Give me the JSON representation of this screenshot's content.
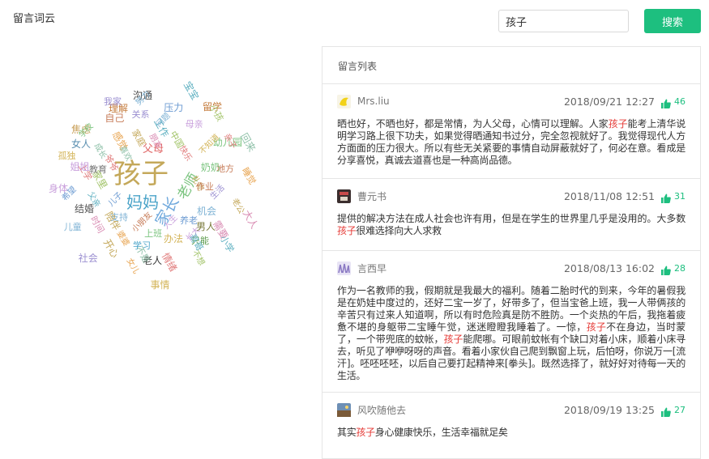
{
  "page": {
    "title": "留言词云"
  },
  "search": {
    "value": "孩子",
    "button": "搜索"
  },
  "word_cloud": {
    "words": [
      "孩子",
      "妈妈",
      "家长",
      "老师",
      "父母",
      "沟通",
      "理解",
      "结婚",
      "男人",
      "老人",
      "女人",
      "教育",
      "焦虑",
      "学习",
      "留学",
      "只能",
      "礼物",
      "支持",
      "工作",
      "长大",
      "上学",
      "幼儿园",
      "女儿",
      "我家",
      "大人",
      "儿子",
      "中国",
      "办法",
      "成长",
      "地方",
      "开心",
      "努力",
      "小学",
      "身体",
      "快乐",
      "上班",
      "感觉",
      "生活",
      "时间",
      "压力",
      "不想",
      "孤独",
      "回来",
      "小朋友",
      "家庭",
      "机会",
      "父亲",
      "母亲",
      "情绪",
      "学校",
      "睡觉",
      "社会",
      "朋友",
      "养老",
      "家里",
      "不知道",
      "不是",
      "自己",
      "老公",
      "儿童",
      "宝宝",
      "人生",
      "爷爷",
      "奶奶",
      "婆婆",
      "关系",
      "需要",
      "希望",
      "小孩",
      "事情",
      "喜欢",
      "作业",
      "陪伴",
      "问题",
      "哥哥",
      "姐姐",
      "亲子"
    ]
  },
  "comments_panel": {
    "header": "留言列表",
    "highlight": "孩子",
    "comments": [
      {
        "username": "Mrs.liu",
        "date": "2018/09/21 12:27",
        "likes": "46",
        "avatar_color": "#f2d21a",
        "text": "晒也好，不晒也好，都是常情，为人父母，心情可以理解。人家孩子能考上清华说明学习路上很下功夫，如果觉得晒通知书过分，完全忽视就好了。我觉得现代人方方面面的压力很大。所以有些无关紧要的事情自动屏蔽就好了，何必在意。看成是分享喜悦，真诚去道喜也是一种高尚品德。"
      },
      {
        "username": "曹元书",
        "date": "2018/11/08 12:51",
        "likes": "31",
        "avatar_color": "#4a3a3a",
        "text": "提供的解决方法在成人社会也许有用，但是在学生的世界里几乎是没用的。大多数孩子很难选择向大人求救"
      },
      {
        "username": "言西早",
        "date": "2018/08/13 16:02",
        "likes": "28",
        "avatar_color": "#8c7bc4",
        "text": "作为一名教师的我，假期就是我最大的福利。随着二胎时代的到来，今年的暑假我是在奶娃中度过的，还好二宝一岁了，好带多了，但当宝爸上班，我一人带俩孩的辛苦只有过来人知道啊，所以有时危险真是防不胜防。一个炎热的午后，我拖着疲惫不堪的身躯带二宝睡午觉，迷迷瞪瞪我睡着了。一惊，孩子不在身边，当时蒙了，一个带兜底的蚊帐，孩子能爬哪。可眼前蚊帐有个缺口对着小床，顺着小床寻去，听见了咿咿呀呀的声音。看着小家伙自己爬到飘窗上玩，后怕呀，你说万一[流汗]。呸呸呸呸，以后自己要打起精神来[拳头]。既然选择了，就好好对待每一天的生活。"
      },
      {
        "username": "风吹随他去",
        "date": "2018/09/19 13:25",
        "likes": "27",
        "avatar_color": "#7a5a38",
        "text": "其实孩子身心健康快乐，生活幸福就足矣"
      }
    ]
  },
  "colors": {
    "accent": "#1dbf7f",
    "highlight": "#e53935"
  }
}
